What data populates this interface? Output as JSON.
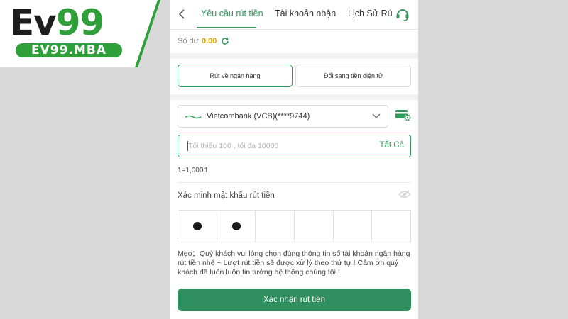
{
  "logo": {
    "wordmark_part1": "Ev",
    "wordmark_part2": "99",
    "domain_badge": "EV99.MBA"
  },
  "header": {
    "back_icon": "chevron-left-icon",
    "tabs": [
      {
        "label": "Yêu cầu rút tiền",
        "active": true
      },
      {
        "label": "Tài khoản nhận",
        "active": false
      },
      {
        "label": "Lịch Sử Rú",
        "active": false
      }
    ],
    "support_icon": "headset-icon"
  },
  "balance": {
    "label": "Số dư",
    "value": "0.00",
    "refresh_icon": "refresh-icon"
  },
  "methods": {
    "bank": "Rút về ngân hàng",
    "ewallet": "Đổi sang tiền điện tử"
  },
  "bank_select": {
    "selected": "Vietcombank (VCB)(****9744)",
    "logo_icon": "vcb-logo-icon",
    "dropdown_icon": "chevron-down-icon",
    "card_settings_icon": "card-gear-icon"
  },
  "amount": {
    "placeholder": "Tối thiểu 100 , tối đa 10000",
    "all_label": "Tất Cả"
  },
  "rate": "1=1,000đ",
  "password": {
    "label": "Xác minh mật khẩu rút tiền",
    "eye_icon": "eye-hidden-icon",
    "filled_digits": 2,
    "total_digits": 6
  },
  "tip": "Mẹo：Quý khách vui lòng chọn đúng thông tin số tài khoản ngân hàng rút tiền nhé ~ Lượt rút tiền sẽ được xử lý theo thứ tự ! Cảm ơn quý khách đã luôn luôn tin tưởng hệ thống chúng tôi !",
  "submit_label": "Xác nhận rút tiền",
  "colors": {
    "accent_green": "#2e9a5b",
    "button_green": "#2f8f5e",
    "balance_gold": "#e0a500",
    "logo_green": "#2f9f3a"
  }
}
